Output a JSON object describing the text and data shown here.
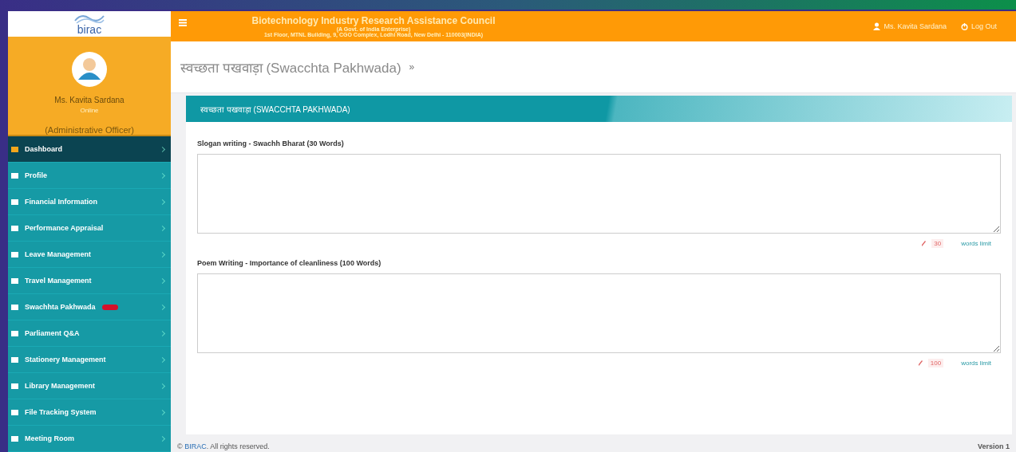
{
  "header": {
    "logo": "birac",
    "title": "Biotechnology Industry Research Assistance Council",
    "subtitle": "(A Govt. of India Enterprise)",
    "address": "1st Floor, MTNL Building, 9, CGO Complex, Lodhi Road, New Delhi - 110003(INDIA)",
    "user": "Ms. Kavita Sardana",
    "logout": "Log Out"
  },
  "profile": {
    "name": "Ms. Kavita Sardana",
    "status": "Online",
    "role": "(Administrative Officer)"
  },
  "menu": [
    {
      "label": "Dashboard",
      "selected": true,
      "badge": false
    },
    {
      "label": "Profile",
      "selected": false,
      "badge": false
    },
    {
      "label": "Financial Information",
      "selected": false,
      "badge": false
    },
    {
      "label": "Performance Appraisal",
      "selected": false,
      "badge": false
    },
    {
      "label": "Leave Management",
      "selected": false,
      "badge": false
    },
    {
      "label": "Travel Management",
      "selected": false,
      "badge": false
    },
    {
      "label": "Swachhta Pakhwada",
      "selected": false,
      "badge": true
    },
    {
      "label": "Parliament Q&A",
      "selected": false,
      "badge": false
    },
    {
      "label": "Stationery Management",
      "selected": false,
      "badge": false
    },
    {
      "label": "Library Management",
      "selected": false,
      "badge": false
    },
    {
      "label": "File Tracking System",
      "selected": false,
      "badge": false
    },
    {
      "label": "Meeting Room",
      "selected": false,
      "badge": false
    }
  ],
  "page_title": "स्वच्छता पखवाड़ा (Swacchta Pakhwada)",
  "breadcrumb_mark": "»",
  "panel": {
    "heading": "स्वच्छता पखवाड़ा (SWACCHTA PAKHWADA)",
    "fields": [
      {
        "label": "Slogan writing - Swachh Bharat (30 Words)",
        "count": "30",
        "limit_text": "words limit"
      },
      {
        "label": "Poem Writing - Importance of cleanliness (100 Words)",
        "count": "100",
        "limit_text": "words limit"
      }
    ]
  },
  "footer": {
    "copyright_mark": "©",
    "copyright_link": "BIRAC",
    "copyright_text": ". All rights reserved.",
    "version": "Version 1"
  }
}
